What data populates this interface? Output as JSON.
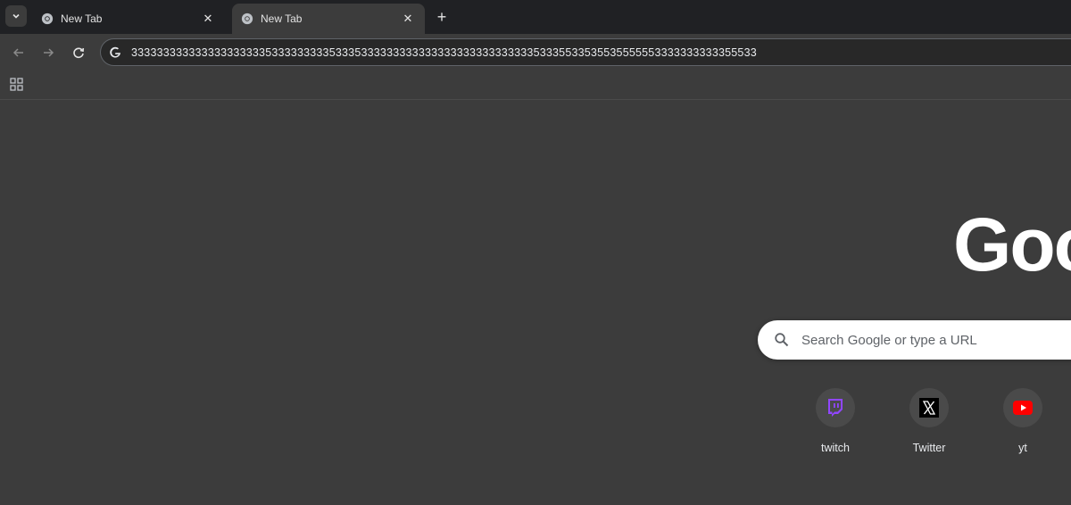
{
  "tabs": [
    {
      "title": "New Tab",
      "active": false
    },
    {
      "title": "New Tab",
      "active": true
    }
  ],
  "icons": {
    "tab_search": "chevron-down-icon",
    "tab_favicon": "chrome-icon",
    "tab_close": "close-icon",
    "new_tab": "plus-icon",
    "back": "arrow-left-icon",
    "forward": "arrow-right-icon",
    "reload": "reload-icon",
    "omnibox": "google-g-icon",
    "apps": "apps-grid-icon",
    "search": "search-icon"
  },
  "omnibox": {
    "value": "33333333333333333333353333333335333533333333333333333333333333353335533535535555553333333333355533"
  },
  "ntp": {
    "logo": "Goo",
    "search_placeholder": "Search Google or type a URL",
    "shortcuts": [
      {
        "label": "twitch",
        "icon": "twitch-icon"
      },
      {
        "label": "Twitter",
        "icon": "x-icon"
      },
      {
        "label": "yt",
        "icon": "youtube-icon"
      }
    ]
  },
  "colors": {
    "tabstrip_bg": "#202124",
    "page_bg": "#3c3c3c",
    "twitch": "#9146ff",
    "youtube": "#ff0000"
  }
}
